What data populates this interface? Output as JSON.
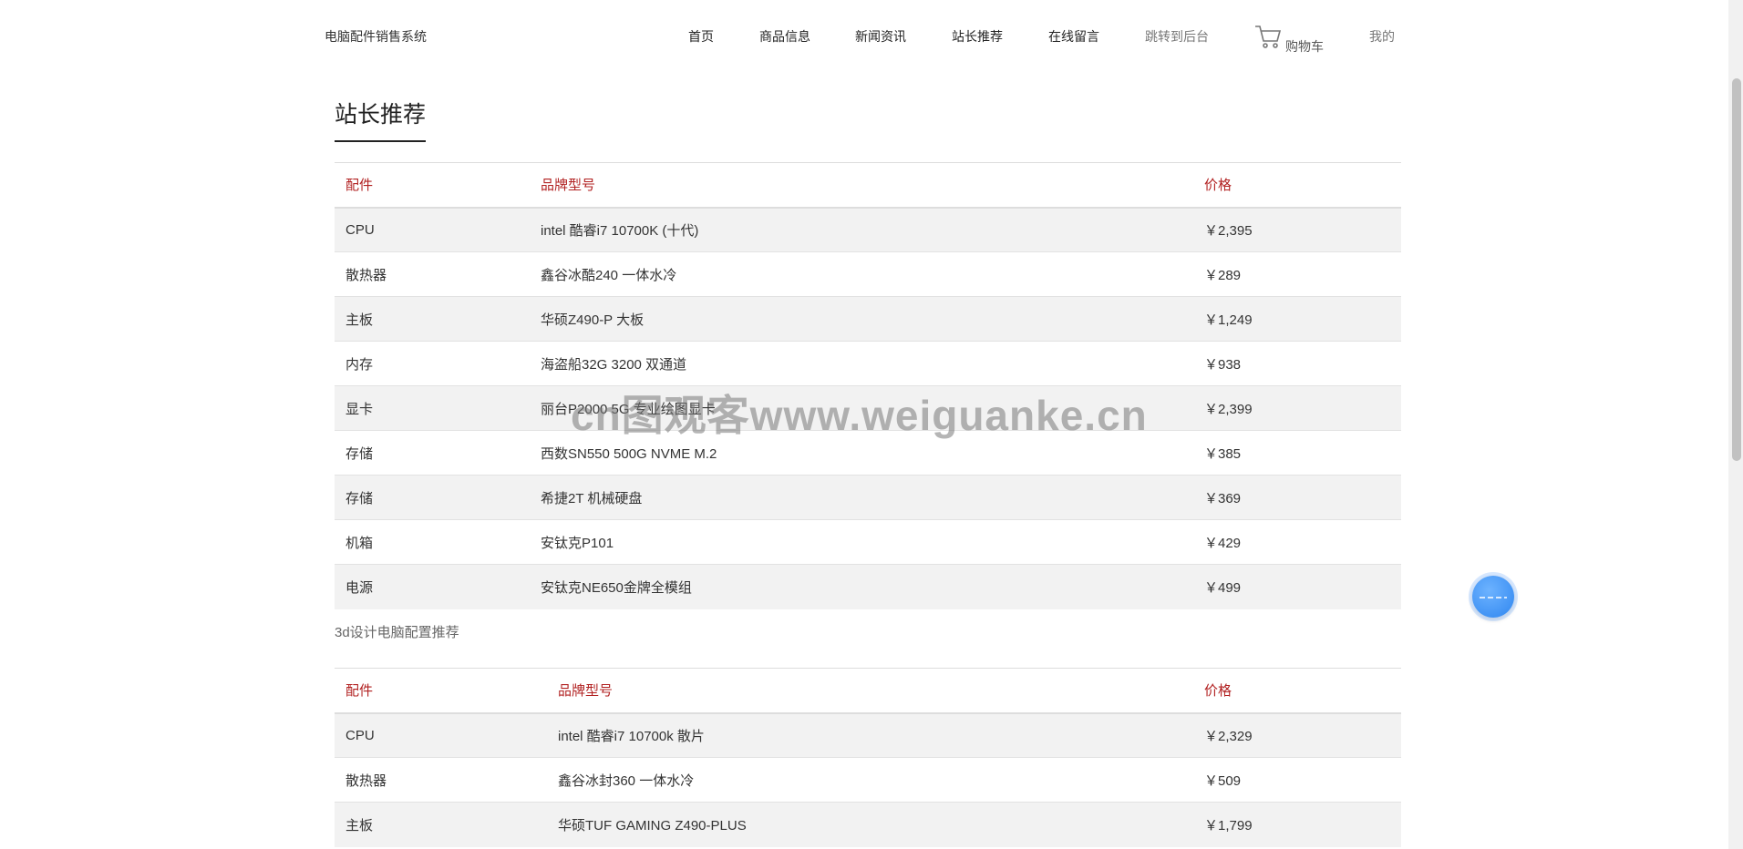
{
  "header": {
    "logo": "电脑配件销售系统",
    "nav": [
      {
        "label": "首页"
      },
      {
        "label": "商品信息"
      },
      {
        "label": "新闻资讯"
      },
      {
        "label": "站长推荐"
      },
      {
        "label": "在线留言"
      },
      {
        "label": "跳转到后台"
      }
    ],
    "cart_label": "购物车",
    "mine_label": "我的"
  },
  "page": {
    "title": "站长推荐",
    "subtitle": "3d设计电脑配置推荐"
  },
  "table1": {
    "headers": [
      "配件",
      "品牌型号",
      "价格"
    ],
    "rows": [
      [
        "CPU",
        "intel 酷睿i7 10700K (十代)",
        "￥2,395"
      ],
      [
        "散热器",
        "鑫谷冰酷240 一体水冷",
        "￥289"
      ],
      [
        "主板",
        "华硕Z490-P 大板",
        "￥1,249"
      ],
      [
        "内存",
        "海盗船32G 3200 双通道",
        "￥938"
      ],
      [
        "显卡",
        "丽台P2000 5G 专业绘图显卡",
        "￥2,399"
      ],
      [
        "存储",
        "西数SN550 500G NVME M.2",
        "￥385"
      ],
      [
        "存储",
        "希捷2T 机械硬盘",
        "￥369"
      ],
      [
        "机箱",
        "安钛克P101",
        "￥429"
      ],
      [
        "电源",
        "安钛克NE650金牌全模组",
        "￥499"
      ]
    ]
  },
  "table2": {
    "headers": [
      "配件",
      "品牌型号",
      "价格"
    ],
    "rows": [
      [
        "CPU",
        "intel 酷睿i7 10700k 散片",
        "￥2,329"
      ],
      [
        "散热器",
        "鑫谷冰封360 一体水冷",
        "￥509"
      ],
      [
        "主板",
        "华硕TUF GAMING Z490-PLUS",
        "￥1,799"
      ]
    ]
  },
  "watermark": "cn图观客www.weiguanke.cn",
  "icons": {
    "cart": "cart-icon",
    "float": "assistant-icon"
  },
  "colors": {
    "header_accent": "#b22222",
    "row_stripe": "#f2f2f2",
    "float_button": "#2f86f0"
  }
}
